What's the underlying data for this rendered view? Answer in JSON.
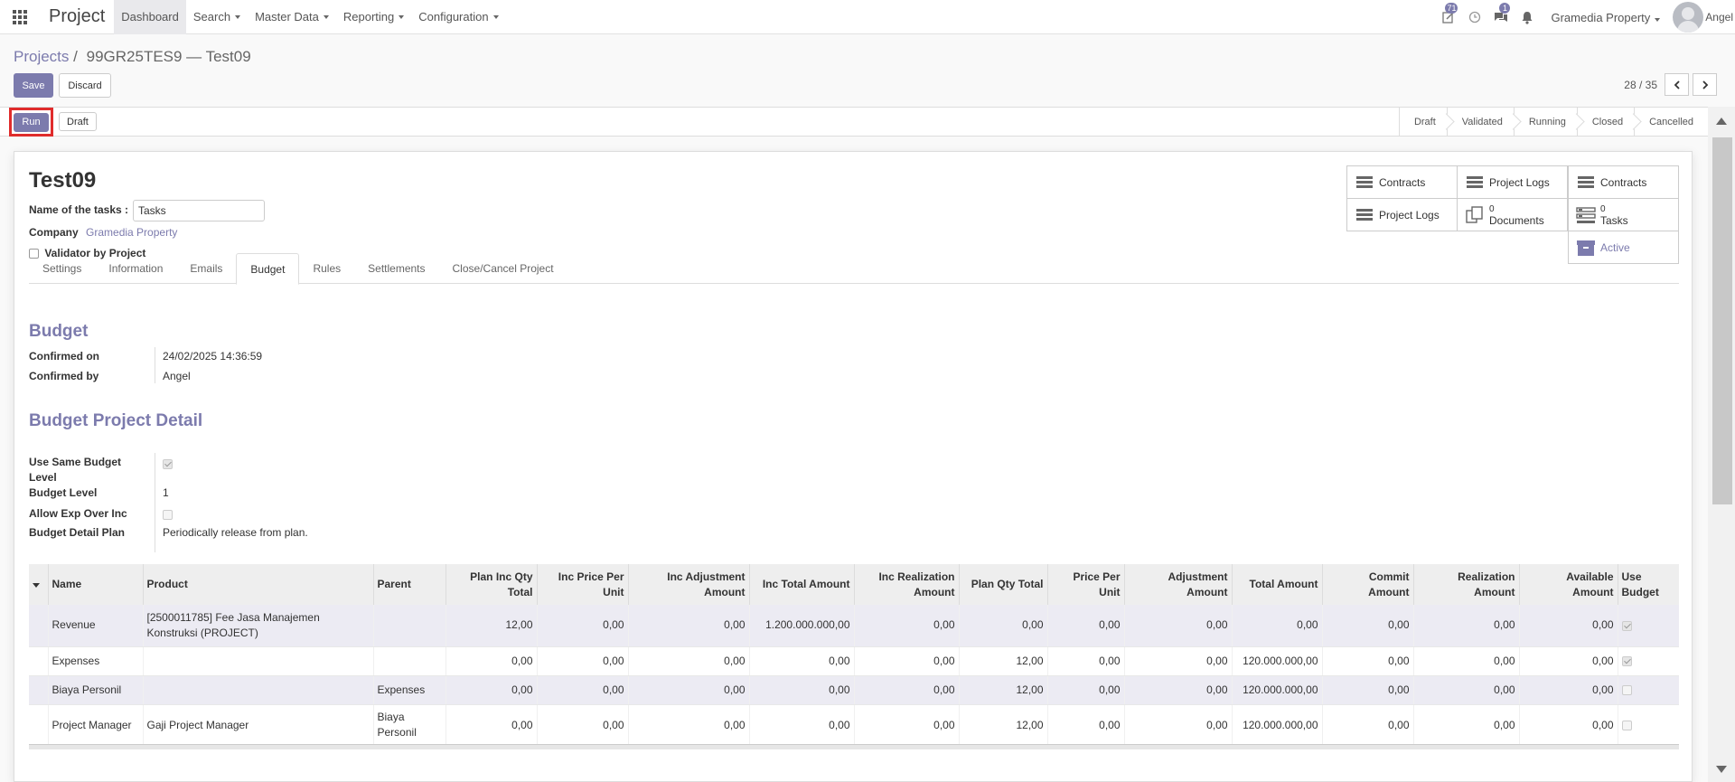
{
  "navbar": {
    "brand": "Project",
    "menu": [
      "Dashboard",
      "Search",
      "Master Data",
      "Reporting",
      "Configuration"
    ],
    "activities_count": "71",
    "messages_count": "1",
    "company": "Gramedia Property",
    "user": "Angel"
  },
  "control": {
    "breadcrumb_parent": "Projects",
    "breadcrumb_sep": "/",
    "breadcrumb_current": "99GR25TES9 — Test09",
    "save": "Save",
    "discard": "Discard",
    "pager": "28 / 35"
  },
  "statusbar": {
    "run": "Run",
    "draft": "Draft",
    "stages": [
      "Draft",
      "Validated",
      "Running",
      "Closed",
      "Cancelled"
    ]
  },
  "form": {
    "title": "Test09",
    "tasks_label": "Name of the tasks :",
    "tasks_value": "Tasks",
    "company_label": "Company",
    "company_value": "Gramedia Property",
    "validator_label": "Validator by Project"
  },
  "smart_buttons": {
    "contracts_1": "Contracts",
    "project_logs_1": "Project Logs",
    "contracts_2": "Contracts",
    "project_logs_2": "Project Logs",
    "documents_count": "0",
    "documents_label": "Documents",
    "tasks_count": "0",
    "tasks_label": "Tasks",
    "active": "Active"
  },
  "tabs": [
    "Settings",
    "Information",
    "Emails",
    "Budget",
    "Rules",
    "Settlements",
    "Close/Cancel Project"
  ],
  "budget": {
    "title": "Budget",
    "confirmed_on_label": "Confirmed on",
    "confirmed_on": "24/02/2025 14:36:59",
    "confirmed_by_label": "Confirmed by",
    "confirmed_by": "Angel",
    "detail_title": "Budget Project Detail",
    "same_level_label": "Use Same Budget Level",
    "level_label": "Budget Level",
    "level": "1",
    "allow_exp_label": "Allow Exp Over Inc",
    "plan_label": "Budget Detail Plan",
    "plan": "Periodically release from plan."
  },
  "table": {
    "headers": [
      "Name",
      "Product",
      "Parent",
      "Plan Inc Qty Total",
      "Inc Price Per Unit",
      "Inc Adjustment Amount",
      "Inc Total Amount",
      "Inc Realization Amount",
      "Plan Qty Total",
      "Price Per Unit",
      "Adjustment Amount",
      "Total Amount",
      "Commit Amount",
      "Realization Amount",
      "Available Amount",
      "Use Budget"
    ],
    "rows": [
      {
        "name": "Revenue",
        "product": "[2500011785] Fee Jasa Manajemen Konstruksi (PROJECT)",
        "parent": "",
        "plan_inc_qty": "12,00",
        "inc_price": "0,00",
        "inc_adj": "0,00",
        "inc_total": "1.200.000.000,00",
        "inc_real": "0,00",
        "plan_qty": "0,00",
        "price": "0,00",
        "adj": "0,00",
        "total": "0,00",
        "commit": "0,00",
        "real": "0,00",
        "avail": "0,00",
        "use_budget": true
      },
      {
        "name": "Expenses",
        "product": "",
        "parent": "",
        "plan_inc_qty": "0,00",
        "inc_price": "0,00",
        "inc_adj": "0,00",
        "inc_total": "0,00",
        "inc_real": "0,00",
        "plan_qty": "12,00",
        "price": "0,00",
        "adj": "0,00",
        "total": "120.000.000,00",
        "commit": "0,00",
        "real": "0,00",
        "avail": "0,00",
        "use_budget": true
      },
      {
        "name": "Biaya Personil",
        "product": "",
        "parent": "Expenses",
        "plan_inc_qty": "0,00",
        "inc_price": "0,00",
        "inc_adj": "0,00",
        "inc_total": "0,00",
        "inc_real": "0,00",
        "plan_qty": "12,00",
        "price": "0,00",
        "adj": "0,00",
        "total": "120.000.000,00",
        "commit": "0,00",
        "real": "0,00",
        "avail": "0,00",
        "use_budget": false
      },
      {
        "name": "Project Manager",
        "product": "Gaji Project Manager",
        "parent": "Biaya Personil",
        "plan_inc_qty": "0,00",
        "inc_price": "0,00",
        "inc_adj": "0,00",
        "inc_total": "0,00",
        "inc_real": "0,00",
        "plan_qty": "12,00",
        "price": "0,00",
        "adj": "0,00",
        "total": "120.000.000,00",
        "commit": "0,00",
        "real": "0,00",
        "avail": "0,00",
        "use_budget": false
      }
    ]
  },
  "colors": {
    "primary": "#7c7bad",
    "highlight": "#e02c2c"
  }
}
